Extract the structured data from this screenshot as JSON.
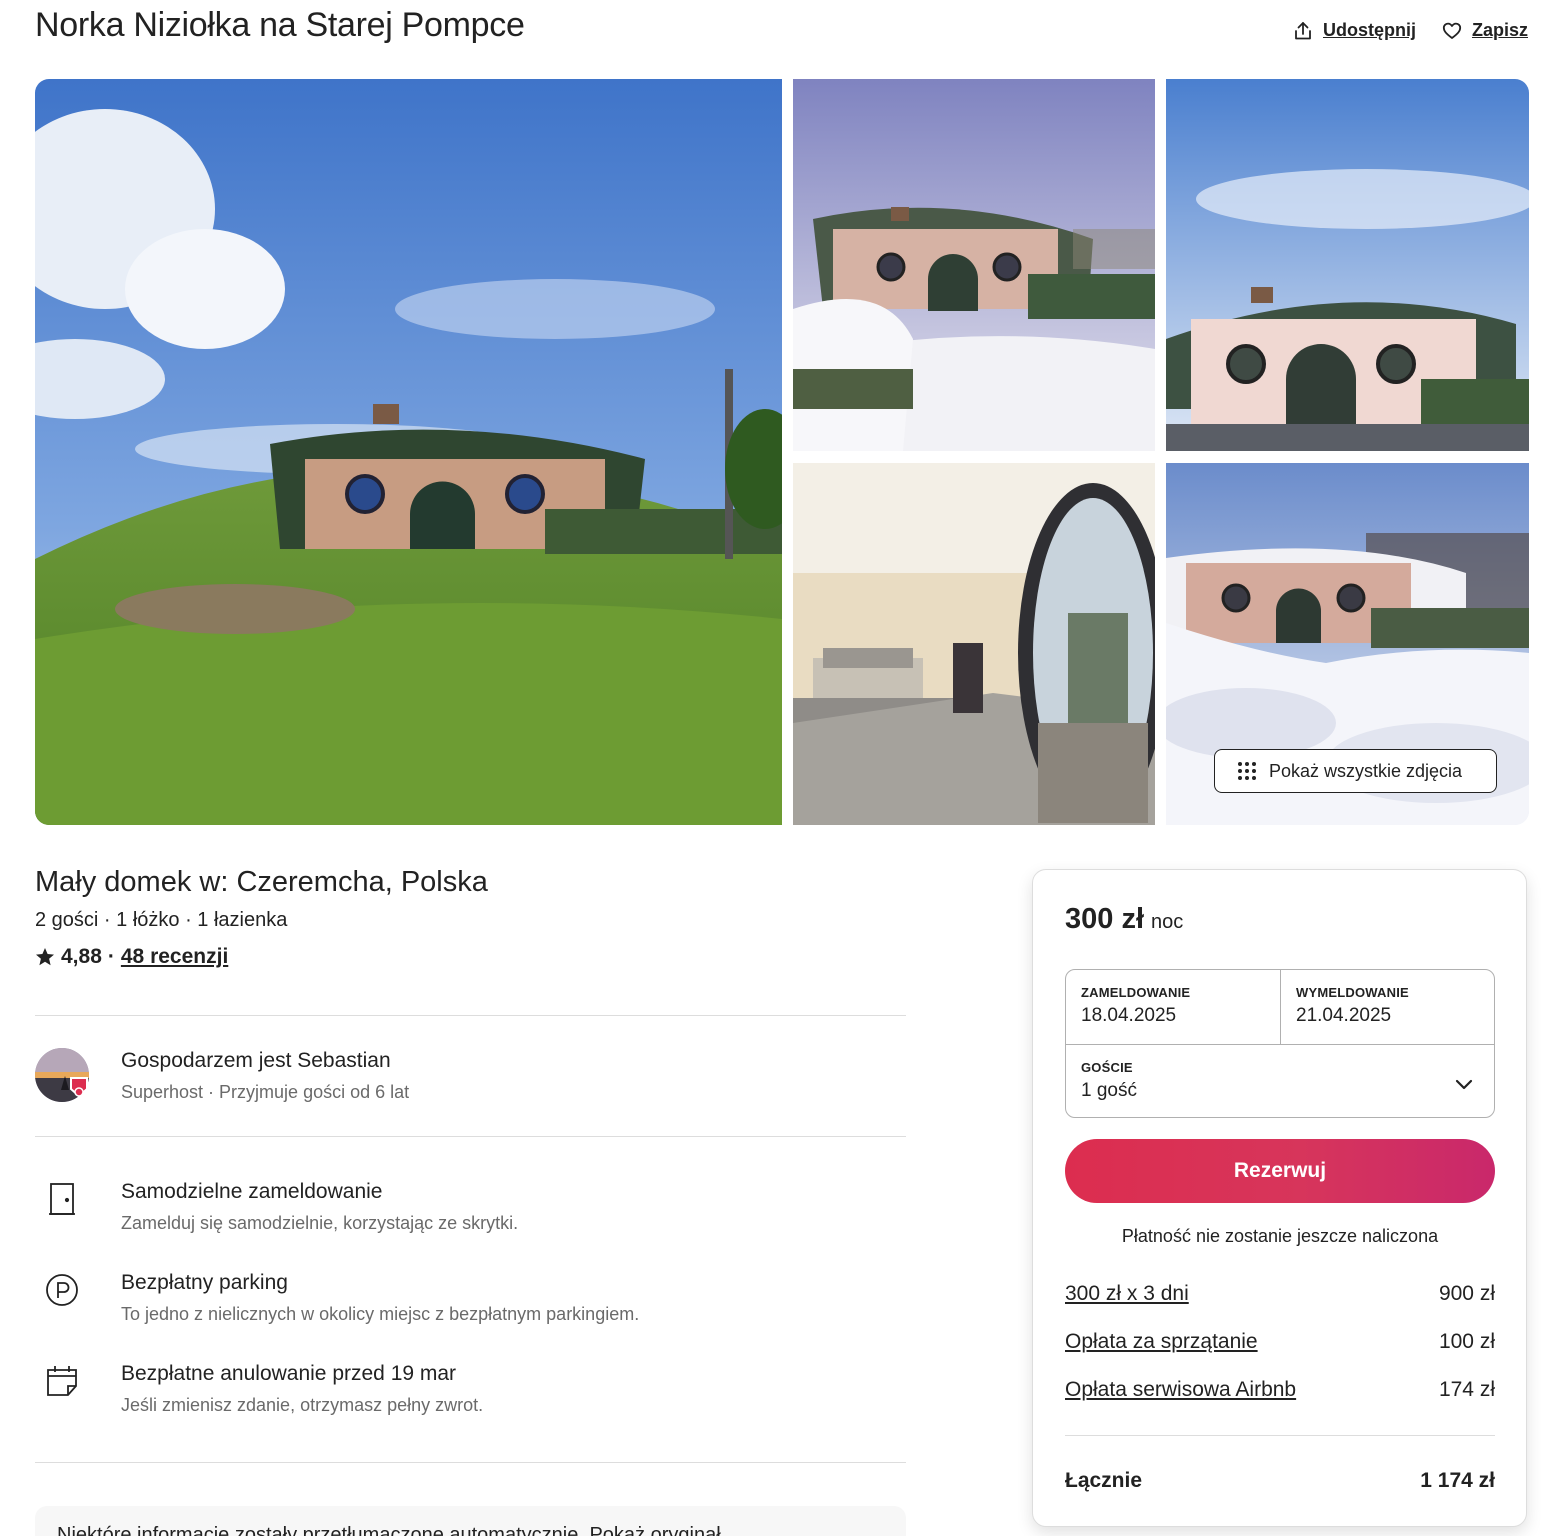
{
  "header": {
    "title": "Norka Niziołka na Starej Pompce",
    "share_label": "Udostępnij",
    "save_label": "Zapisz"
  },
  "gallery": {
    "show_all_label": "Pokaż wszystkie zdjęcia",
    "photos": [
      "hobbit-house-summer",
      "hobbit-house-winter-snow",
      "hobbit-house-clear-sky",
      "bedroom-interior-round-door",
      "hobbit-house-deep-snow"
    ]
  },
  "listing": {
    "subtitle": "Mały domek w: Czeremcha, Polska",
    "info": "2 gości · 1 łóżko · 1 łazienka",
    "rating": "4,88",
    "rating_separator": "·",
    "reviews_label": "48 recenzji"
  },
  "host": {
    "name": "Gospodarzem jest Sebastian",
    "subtitle": "Superhost · Przyjmuje gości od 6 lat"
  },
  "features": [
    {
      "icon": "door-icon",
      "title": "Samodzielne zameldowanie",
      "desc": "Zamelduj się samodzielnie, korzystając ze skrytki."
    },
    {
      "icon": "parking-icon",
      "title": "Bezpłatny parking",
      "desc": "To jedno z nielicznych w okolicy miejsc z bezpłatnym parkingiem."
    },
    {
      "icon": "calendar-icon",
      "title": "Bezpłatne anulowanie przed 19 mar",
      "desc": "Jeśli zmienisz zdanie, otrzymasz pełny zwrot."
    }
  ],
  "notice": {
    "text": "Niektóre informacje zostały przetłumaczone automatycznie. Pokaż oryginał"
  },
  "booking": {
    "price": "300 zł",
    "per": "noc",
    "checkin_label": "ZAMELDOWANIE",
    "checkin_value": "18.04.2025",
    "checkout_label": "WYMELDOWANIE",
    "checkout_value": "21.04.2025",
    "guests_label": "GOŚCIE",
    "guests_value": "1 gość",
    "reserve_label": "Rezerwuj",
    "no_charge": "Płatność nie zostanie jeszcze naliczona",
    "lines": [
      {
        "label": "300 zł x 3 dni",
        "value": "900 zł"
      },
      {
        "label": "Opłata za sprzątanie",
        "value": "100 zł"
      },
      {
        "label": "Opłata serwisowa Airbnb",
        "value": "174 zł"
      }
    ],
    "total_label": "Łącznie",
    "total_value": "1 174 zł"
  },
  "colors": {
    "accent": "#dc2d4f",
    "text": "#222222",
    "muted": "#6a6a6a",
    "border": "#dddddd"
  }
}
